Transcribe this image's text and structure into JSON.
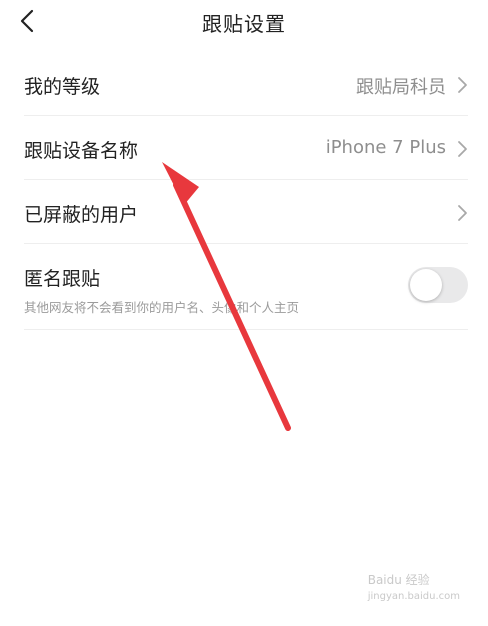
{
  "header": {
    "title": "跟贴设置"
  },
  "settings": {
    "level": {
      "label": "我的等级",
      "value": "跟贴局科员"
    },
    "device_name": {
      "label": "跟贴设备名称",
      "value": "iPhone 7 Plus"
    },
    "blocked_users": {
      "label": "已屏蔽的用户"
    },
    "anonymous": {
      "label": "匿名跟贴",
      "description": "其他网友将不会看到你的用户名、头像和个人主页",
      "enabled": false
    }
  },
  "annotation": {
    "color": "#e8383d"
  },
  "watermark": {
    "text": "Baidu 经验",
    "subtext": "jingyan.baidu.com"
  }
}
